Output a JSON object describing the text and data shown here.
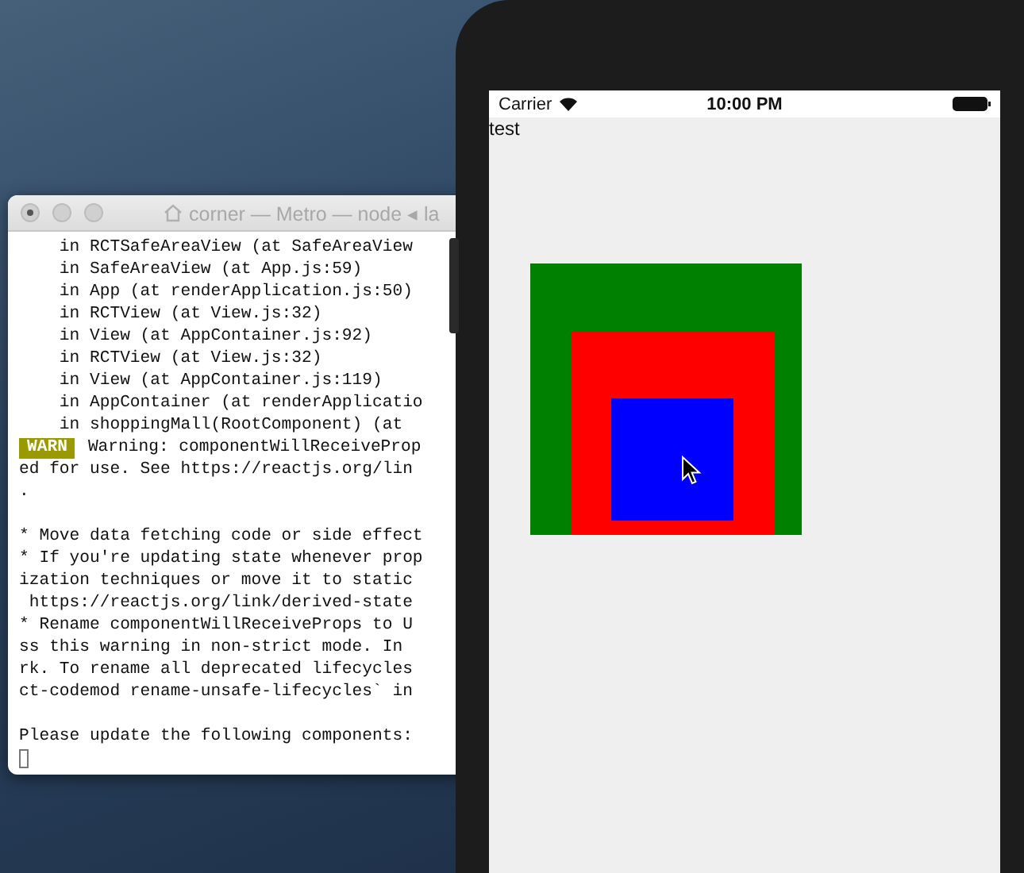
{
  "terminal": {
    "title": "corner — Metro — node ◂ la",
    "lines": [
      {
        "kind": "text",
        "text": "    in RCTSafeAreaView (at SafeAreaView"
      },
      {
        "kind": "text",
        "text": "    in SafeAreaView (at App.js:59)"
      },
      {
        "kind": "text",
        "text": "    in App (at renderApplication.js:50)"
      },
      {
        "kind": "text",
        "text": "    in RCTView (at View.js:32)"
      },
      {
        "kind": "text",
        "text": "    in View (at AppContainer.js:92)"
      },
      {
        "kind": "text",
        "text": "    in RCTView (at View.js:32)"
      },
      {
        "kind": "text",
        "text": "    in View (at AppContainer.js:119)"
      },
      {
        "kind": "text",
        "text": "    in AppContainer (at renderApplicatio"
      },
      {
        "kind": "text",
        "text": "    in shoppingMall(RootComponent) (at"
      },
      {
        "kind": "warn",
        "badge": "WARN",
        "text": "Warning: componentWillReceiveProp"
      },
      {
        "kind": "text",
        "text": "ed for use. See https://reactjs.org/lin"
      },
      {
        "kind": "text",
        "text": "."
      },
      {
        "kind": "blank"
      },
      {
        "kind": "text",
        "text": "* Move data fetching code or side effect"
      },
      {
        "kind": "text",
        "text": "* If you're updating state whenever prop"
      },
      {
        "kind": "text",
        "text": "ization techniques or move it to static"
      },
      {
        "kind": "text",
        "text": " https://reactjs.org/link/derived-state"
      },
      {
        "kind": "text",
        "text": "* Rename componentWillReceiveProps to U"
      },
      {
        "kind": "text",
        "text": "ss this warning in non-strict mode. In"
      },
      {
        "kind": "text",
        "text": "rk. To rename all deprecated lifecycles"
      },
      {
        "kind": "text",
        "text": "ct-codemod rename-unsafe-lifecycles` in"
      },
      {
        "kind": "blank"
      },
      {
        "kind": "text",
        "text": "Please update the following components:"
      },
      {
        "kind": "cursor"
      }
    ]
  },
  "simulator": {
    "status_bar": {
      "carrier": "Carrier",
      "time": "10:00 PM"
    },
    "app": {
      "label": "test",
      "squares": [
        {
          "color": "#008000"
        },
        {
          "color": "#ff0000"
        },
        {
          "color": "#0000ff"
        }
      ]
    }
  }
}
